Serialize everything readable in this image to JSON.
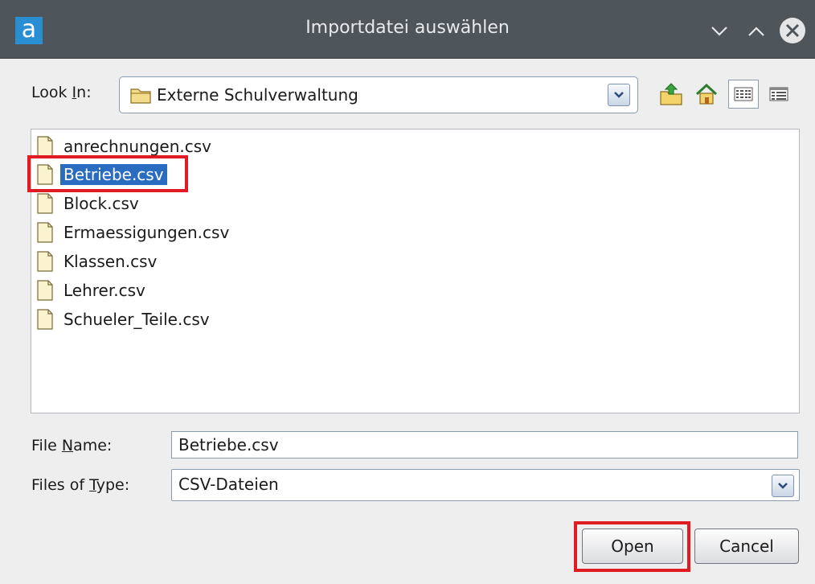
{
  "window": {
    "title": "Importdatei auswählen",
    "logo_letter": "a"
  },
  "look_in": {
    "label_prefix": "Look ",
    "label_mnemonic": "I",
    "label_suffix": "n:",
    "value": "Externe Schulverwaltung"
  },
  "files": [
    {
      "name": "anrechnungen.csv",
      "selected": false
    },
    {
      "name": "Betriebe.csv",
      "selected": true
    },
    {
      "name": "Block.csv",
      "selected": false
    },
    {
      "name": "Ermaessigungen.csv",
      "selected": false
    },
    {
      "name": "Klassen.csv",
      "selected": false
    },
    {
      "name": "Lehrer.csv",
      "selected": false
    },
    {
      "name": "Schueler_Teile.csv",
      "selected": false
    }
  ],
  "file_name": {
    "label_prefix": "File ",
    "label_mnemonic": "N",
    "label_suffix": "ame:",
    "value": "Betriebe.csv"
  },
  "file_type": {
    "label_prefix": "Files of ",
    "label_mnemonic": "T",
    "label_suffix": "ype:",
    "value": "CSV-Dateien"
  },
  "buttons": {
    "open": "Open",
    "cancel": "Cancel"
  },
  "colors": {
    "titlebar": "#4e555b",
    "selection": "#2a6cc0",
    "highlight": "#e01b24"
  }
}
